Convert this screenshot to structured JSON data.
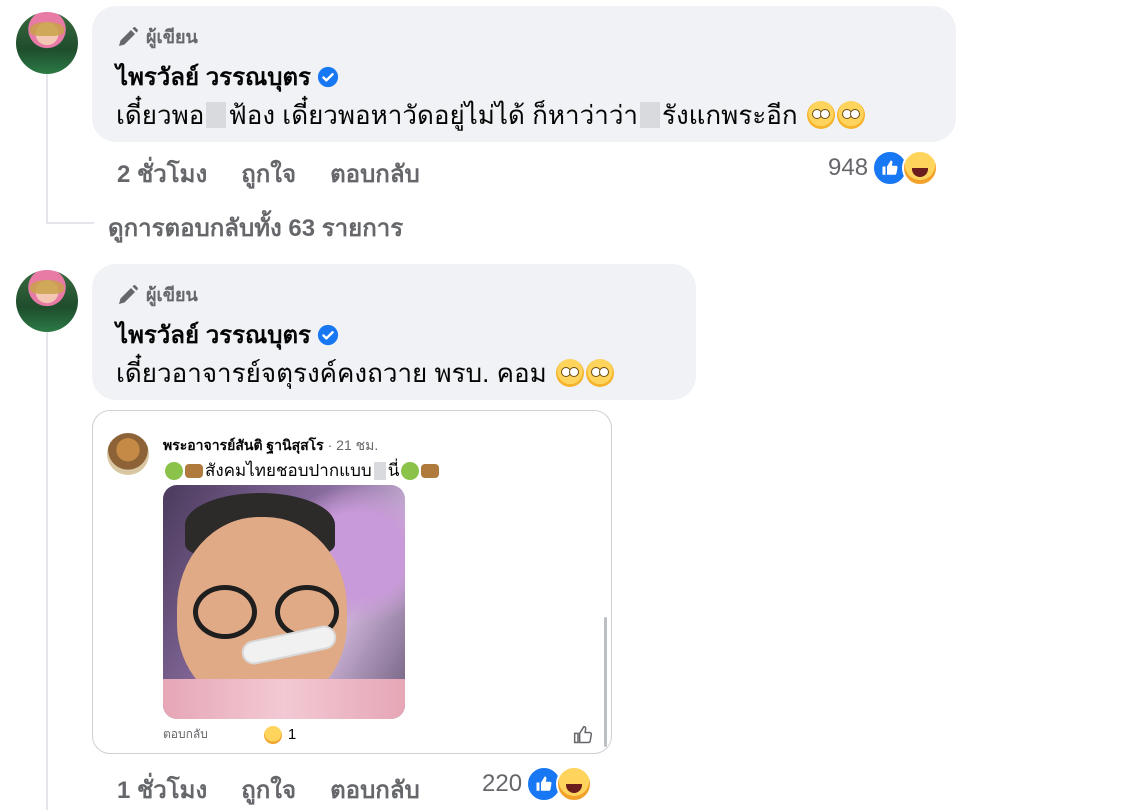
{
  "comments": [
    {
      "author_tag": "ผู้เขียน",
      "author": "ไพรวัลย์ วรรณบุตร",
      "text_parts": [
        "เดี๋ยวพอ",
        "ฟ้อง เดี๋ยวพอหาวัดอยู่ไม่ได้ ก็หาว่าว่า",
        "รังแกพระอีก"
      ],
      "time": "2 ชั่วโมง",
      "like_label": "ถูกใจ",
      "reply_label": "ตอบกลับ",
      "reaction_count": "948",
      "view_replies": "ดูการตอบกลับทั้ง 63 รายการ"
    },
    {
      "author_tag": "ผู้เขียน",
      "author": "ไพรวัลย์ วรรณบุตร",
      "text": "เดี๋ยวอาจารย์จตุรงค์คงถวาย พรบ. คอม",
      "time": "1 ชั่วโมง",
      "like_label": "ถูกใจ",
      "reply_label": "ตอบกลับ",
      "reaction_count": "220",
      "embed": {
        "name": "พระอาจารย์สันติ ฐานิสุสโร",
        "time": " · 21 ชม.",
        "text_parts": [
          "สังคมไทยชอบปากแบบ",
          "นี่"
        ],
        "reply_label": "ตอบกลับ",
        "reaction_count": "1"
      }
    }
  ],
  "icons": {
    "pen": "pen-icon",
    "verified": "verified-badge-icon",
    "like": "like-reaction-icon",
    "haha": "haha-reaction-icon",
    "eyeroll": "eyeroll-emoji-icon",
    "thumb": "thumbs-up-icon"
  },
  "colors": {
    "bubble": "#f0f2f5",
    "secondary_text": "#65676b",
    "accent_blue": "#1877f2"
  }
}
